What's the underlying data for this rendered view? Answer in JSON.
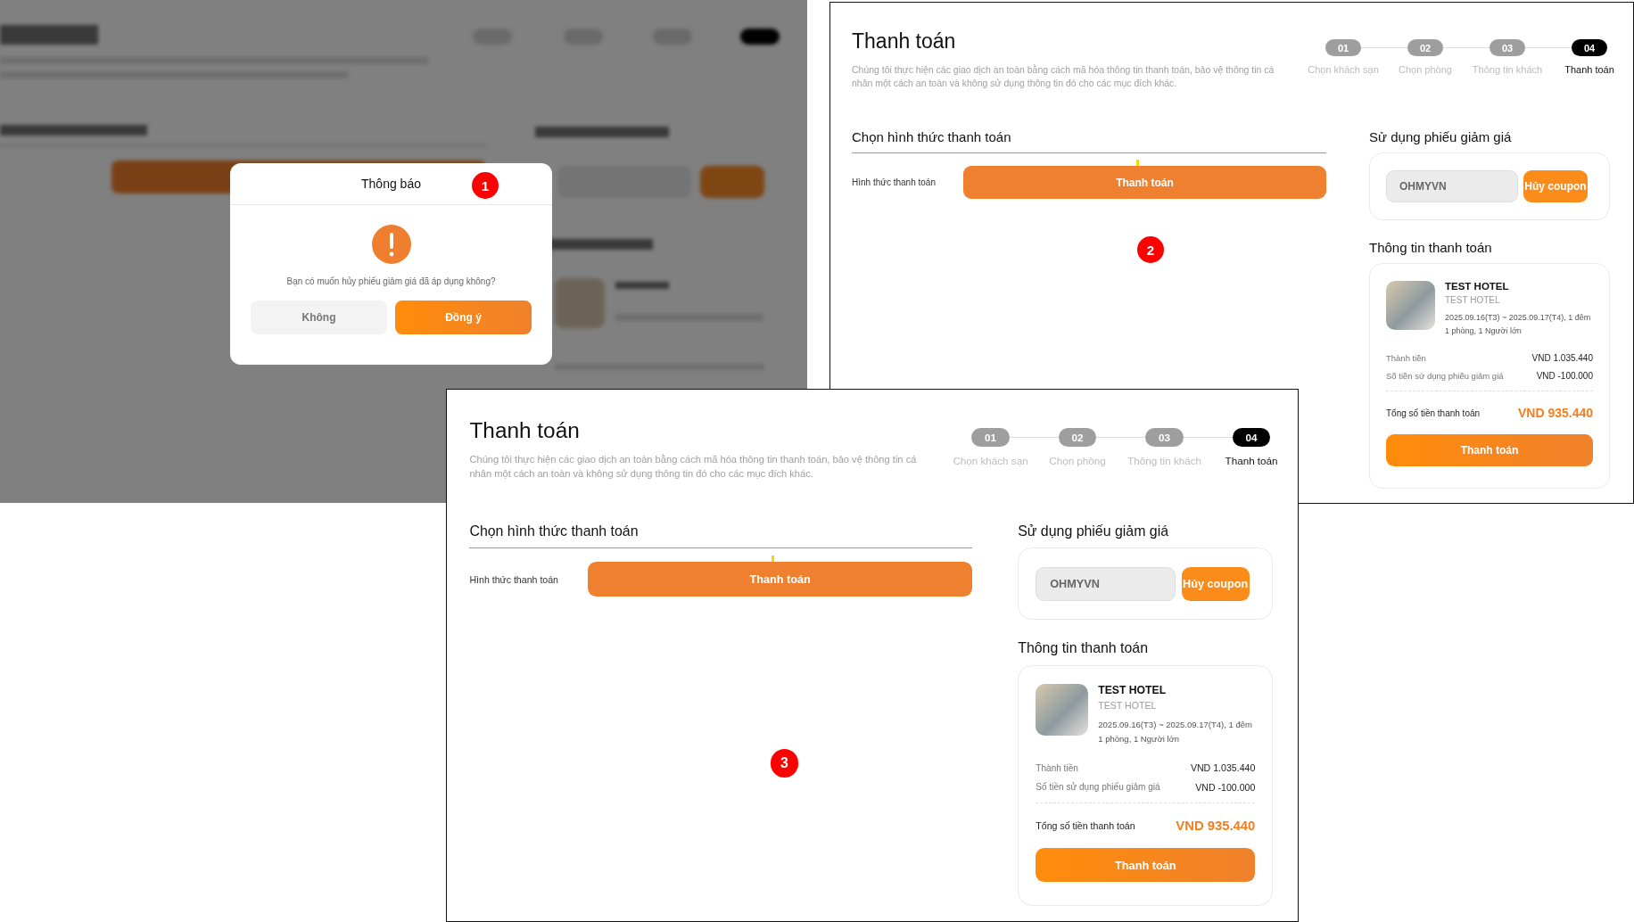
{
  "screens": [
    {
      "kind": "dialog",
      "marker": "1",
      "dialog": {
        "title": "Thông báo",
        "message": "Bạn có muốn hủy phiếu giảm giá đã áp dụng không?",
        "buttons": [
          {
            "label": "Không",
            "kind": "secondary"
          },
          {
            "label": "Đồng ý",
            "kind": "primary"
          }
        ]
      }
    },
    {
      "kind": "page",
      "marker": "2",
      "page": {
        "title": "Thanh toán",
        "description": "Chúng tôi thực hiện các giao dịch an toàn bằng cách mã hóa thông tin thanh toán, bảo vệ thông tin cá nhân một cách an toàn và không sử dụng thông tin đó cho các mục đích khác.",
        "steps": [
          {
            "number": "01",
            "label": "Chọn khách sạn",
            "selected": false
          },
          {
            "number": "02",
            "label": "Chọn phòng",
            "selected": false
          },
          {
            "number": "03",
            "label": "Thông tin khách",
            "selected": false
          },
          {
            "number": "04",
            "label": "Thanh toán",
            "selected": true
          }
        ],
        "payment_method": {
          "heading": "Chọn hình thức thanh toán",
          "label": "Hình thức thanh toán",
          "button": "Thanh toán"
        },
        "coupon": {
          "heading": "Sử dụng phiếu giảm giá",
          "value": "OHMYVN",
          "button": "Hủy coupon"
        },
        "summary": {
          "heading": "Thông tin thanh toán",
          "hotel": {
            "name": "TEST HOTEL",
            "subtitle": "TEST HOTEL",
            "dates": "2025.09.16(T3) ~ 2025.09.17(T4), 1 đêm",
            "guests": "1 phòng, 1 Người lớn"
          },
          "lines": [
            {
              "label": "Thành tiền",
              "value": "VND 1.035.440"
            },
            {
              "label": "Số tiền sử dụng phiếu giảm giá",
              "value": "VND -100.000"
            }
          ],
          "total": {
            "label": "Tổng số tiền thanh toán",
            "value": "VND 935.440"
          },
          "button": "Thanh toán"
        }
      }
    },
    {
      "kind": "page",
      "marker": "3",
      "page": {
        "title": "Thanh toán",
        "description": "Chúng tôi thực hiện các giao dịch an toàn bằng cách mã hóa thông tin thanh toán, bảo vệ thông tin cá nhân một cách an toàn và không sử dụng thông tin đó cho các mục đích khác.",
        "steps": [
          {
            "number": "01",
            "label": "Chọn khách sạn",
            "selected": false
          },
          {
            "number": "02",
            "label": "Chọn phòng",
            "selected": false
          },
          {
            "number": "03",
            "label": "Thông tin khách",
            "selected": false
          },
          {
            "number": "04",
            "label": "Thanh toán",
            "selected": true
          }
        ],
        "payment_method": {
          "heading": "Chọn hình thức thanh toán",
          "label": "Hình thức thanh toán",
          "button": "Thanh toán"
        },
        "coupon": {
          "heading": "Sử dụng phiếu giảm giá",
          "value": "OHMYVN",
          "button": "Hủy coupon"
        },
        "summary": {
          "heading": "Thông tin thanh toán",
          "hotel": {
            "name": "TEST HOTEL",
            "subtitle": "TEST HOTEL",
            "dates": "2025.09.16(T3) ~ 2025.09.17(T4), 1 đêm",
            "guests": "1 phòng, 1 Người lớn"
          },
          "lines": [
            {
              "label": "Thành tiền",
              "value": "VND 1.035.440"
            },
            {
              "label": "Số tiền sử dụng phiếu giảm giá",
              "value": "VND -100.000"
            }
          ],
          "total": {
            "label": "Tổng số tiền thanh toán",
            "value": "VND 935.440"
          },
          "button": "Thanh toán"
        }
      }
    }
  ]
}
